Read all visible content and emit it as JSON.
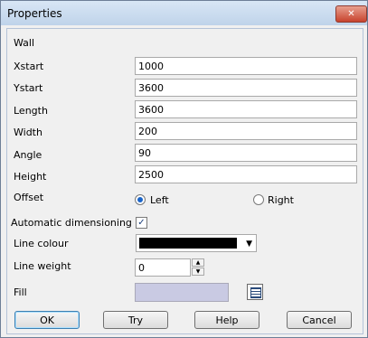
{
  "window": {
    "title": "Properties",
    "close_symbol": "✕"
  },
  "section": {
    "title": "Wall"
  },
  "fields": {
    "xstart": {
      "label": "Xstart",
      "value": "1000"
    },
    "ystart": {
      "label": "Ystart",
      "value": "3600"
    },
    "length": {
      "label": "Length",
      "value": "3600"
    },
    "width": {
      "label": "Width",
      "value": "200"
    },
    "angle": {
      "label": "Angle",
      "value": "90"
    },
    "height": {
      "label": "Height",
      "value": "2500"
    }
  },
  "offset": {
    "label": "Offset",
    "option_left": "Left",
    "option_right": "Right",
    "selected": "Left"
  },
  "auto_dim": {
    "label": "Automatic dimensioning",
    "checked": true,
    "check_glyph": "✓"
  },
  "line_colour": {
    "label": "Line colour",
    "value_color": "#000000",
    "arrow": "▼"
  },
  "line_weight": {
    "label": "Line weight",
    "value": "0",
    "up": "▲",
    "down": "▼"
  },
  "fill": {
    "label": "Fill",
    "color": "#c9cae3"
  },
  "buttons": {
    "ok": "OK",
    "try": "Try",
    "help": "Help",
    "cancel": "Cancel"
  }
}
